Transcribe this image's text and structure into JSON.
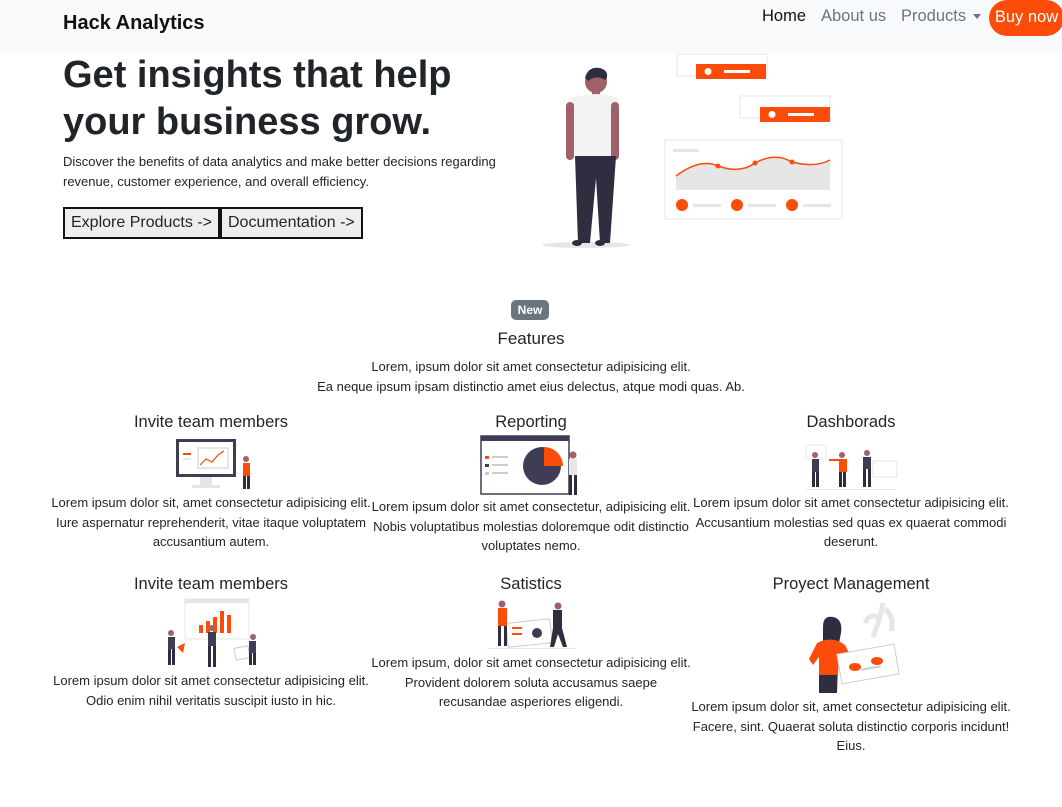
{
  "navbar": {
    "brand": "Hack Analytics",
    "links": [
      "Home",
      "About us",
      "Products"
    ],
    "buy_label": "Buy now",
    "accent": "#fb4c0a"
  },
  "hero": {
    "title": "Get insights that help your business grow.",
    "lead": "Discover the benefits of data analytics and make better decisions regarding revenue, customer experience, and overall efficiency.",
    "buttons": [
      "Explore Products ->",
      "Documentation ->"
    ]
  },
  "features_section": {
    "badge": "New",
    "title": "Features",
    "desc_line1": "Lorem, ipsum dolor sit amet consectetur adipisicing elit.",
    "desc_line2": "Ea neque ipsum ipsam distinctio amet eius delectus, atque modi quas. Ab."
  },
  "features": [
    {
      "title": "Invite team members",
      "text": "Lorem ipsum dolor sit, amet consectetur adipisicing elit. Iure aspernatur reprehenderit, vitae itaque voluptatem accusantium autem."
    },
    {
      "title": "Reporting",
      "text": "Lorem ipsum dolor sit amet consectetur, adipisicing elit. Nobis voluptatibus molestias doloremque odit distinctio voluptates nemo."
    },
    {
      "title": "Dashborads",
      "text": "Lorem ipsum dolor sit amet consectetur adipisicing elit. Accusantium molestias sed quas ex quaerat commodi deserunt."
    },
    {
      "title": "Invite team members",
      "text": "Lorem ipsum dolor sit amet consectetur adipisicing elit. Odio enim nihil veritatis suscipit iusto in hic."
    },
    {
      "title": "Satistics",
      "text": "Lorem ipsum, dolor sit amet consectetur adipisicing elit. Provident dolorem soluta accusamus saepe recusandae asperiores eligendi."
    },
    {
      "title": "Proyect Management",
      "text": "Lorem ipsum dolor sit, amet consectetur adipisicing elit. Facere, sint. Quaerat soluta distinctio corporis incidunt! Eius."
    }
  ]
}
